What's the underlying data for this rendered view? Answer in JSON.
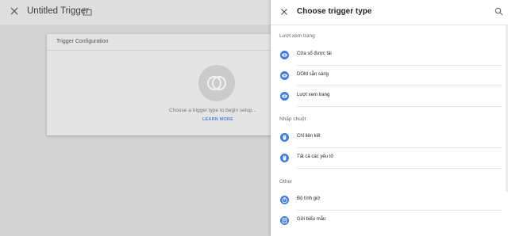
{
  "header": {
    "title": "Untitled Trigger"
  },
  "card": {
    "heading": "Trigger Configuration",
    "prompt": "Choose a trigger type to begin setup...",
    "learn_more": "LEARN MORE"
  },
  "panel": {
    "title": "Choose trigger type",
    "sections": [
      {
        "label": "Lượt xem trang",
        "items": [
          {
            "label": "Cửa sổ được tải",
            "icon": "eye-icon"
          },
          {
            "label": "DOM sẵn sàng",
            "icon": "eye-icon"
          },
          {
            "label": "Lượt xem trang",
            "icon": "eye-icon"
          }
        ]
      },
      {
        "label": "Nhấp chuột",
        "items": [
          {
            "label": "Chỉ liên kết",
            "icon": "mouse-icon"
          },
          {
            "label": "Tất cả các yếu tố",
            "icon": "mouse-icon"
          }
        ]
      },
      {
        "label": "Other",
        "items": [
          {
            "label": "Bộ tính giờ",
            "icon": "timer-icon"
          },
          {
            "label": "Gửi biểu mẫu",
            "icon": "form-submit-icon"
          }
        ]
      }
    ]
  },
  "colors": {
    "accent": "#3f7de0",
    "link": "#5b86d6"
  }
}
